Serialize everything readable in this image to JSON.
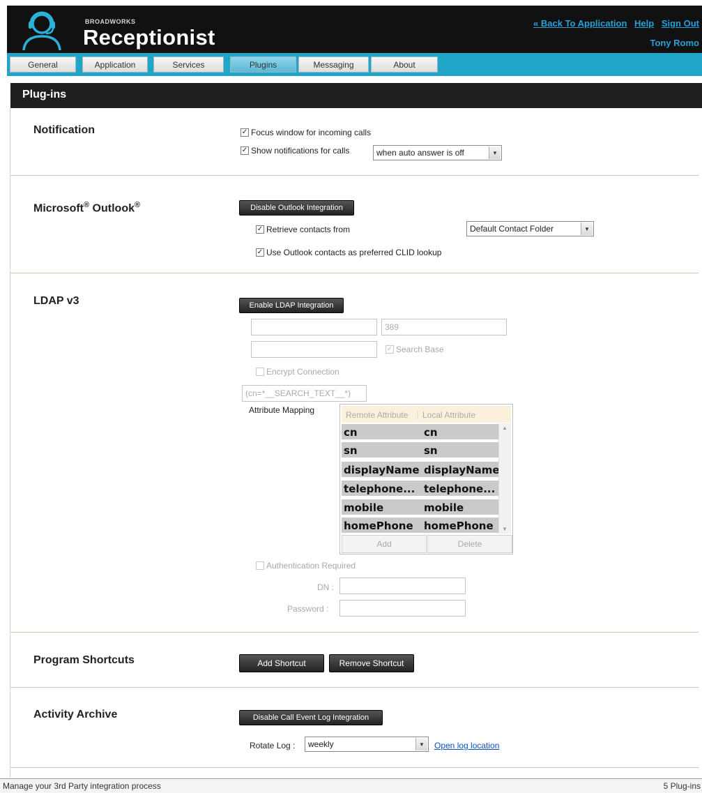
{
  "header": {
    "brand_small": "BROADWORKS",
    "brand_big": "Receptionist",
    "links": [
      "« Back To Application",
      "Help",
      "Sign Out"
    ],
    "username": "Tony Romo",
    "logo_icon": "headset-person-icon"
  },
  "tabs": [
    {
      "label": "General",
      "active": false
    },
    {
      "label": "Application",
      "active": false
    },
    {
      "label": "Services",
      "active": false
    },
    {
      "label": "Plugins",
      "active": true
    },
    {
      "label": "Messaging",
      "active": false
    },
    {
      "label": "About",
      "active": false
    }
  ],
  "page_title": "Plug-ins",
  "notification": {
    "title": "Notification",
    "focus_window": {
      "label": "Focus window for incoming calls",
      "checked": true
    },
    "show_notifications": {
      "label": "Show notifications for calls",
      "checked": true
    },
    "show_select_value": "when auto answer is off"
  },
  "outlook": {
    "title_main": "Microsoft",
    "title_reg": "®",
    "title_main2": " Outlook",
    "title_reg2": "®",
    "button": "Disable Outlook Integration",
    "retrieve": {
      "label": "Retrieve contacts from",
      "checked": true
    },
    "folder_select": "Default Contact Folder",
    "clid": {
      "label": "Use Outlook contacts as preferred CLID lookup",
      "checked": true
    }
  },
  "ldap": {
    "title": "LDAP v3",
    "button": "Enable LDAP Integration",
    "server_value": "",
    "port_value": "389",
    "search_base_value": "",
    "search_base_check": {
      "label": "Search Base",
      "checked": true
    },
    "encrypt": {
      "label": "Encrypt Connection",
      "checked": false
    },
    "filter_value": "(cn=*__SEARCH_TEXT__*)",
    "attribute_mapping_label": "Attribute Mapping",
    "table_headers": [
      "Remote Attribute",
      "Local Attribute"
    ],
    "rows": [
      {
        "remote": "cn",
        "local": "cn"
      },
      {
        "remote": "sn",
        "local": "sn"
      },
      {
        "remote": "displayName",
        "local": "displayName"
      },
      {
        "remote": "telephone...",
        "local": "telephone..."
      },
      {
        "remote": "mobile",
        "local": "mobile"
      },
      {
        "remote": "homePhone",
        "local": "homePhone"
      }
    ],
    "add": "Add",
    "delete": "Delete",
    "auth": {
      "label": "Authentication Required",
      "checked": false
    },
    "dn_label": "DN :",
    "password_label": "Password :"
  },
  "shortcuts": {
    "title": "Program Shortcuts",
    "add": "Add Shortcut",
    "remove": "Remove Shortcut"
  },
  "archive": {
    "title": "Activity Archive",
    "button": "Disable Call Event Log Integration",
    "rotate_label": "Rotate Log :",
    "rotate_value": "weekly",
    "open_link": "Open log location"
  },
  "status": {
    "left": "Manage your 3rd Party integration process",
    "right": "5 Plug-ins"
  },
  "colors": {
    "header_bg": "#111111",
    "tab_bar": "#21a6c9",
    "link_blue": "#2aa0d8",
    "active_tab": "#5ab9d6"
  }
}
